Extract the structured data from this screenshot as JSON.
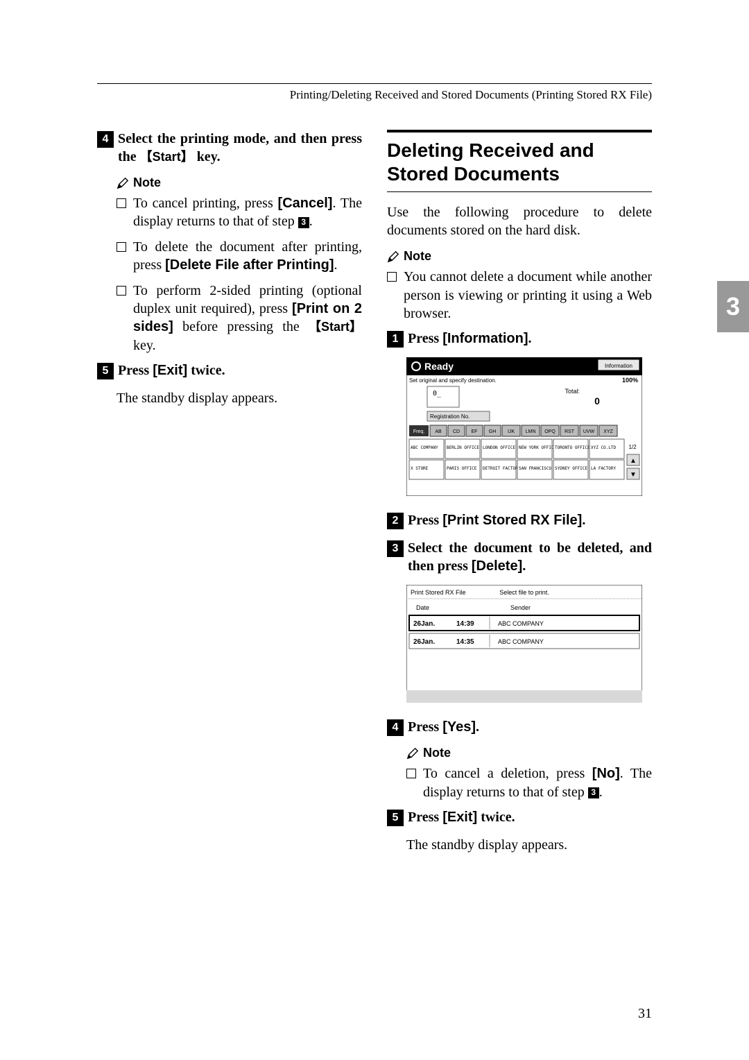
{
  "runningHead": "Printing/Deleting Received and Stored Documents (Printing Stored RX File)",
  "left": {
    "step4": {
      "num": "4",
      "textA": "Select the printing mode, and then press the ",
      "key": "Start",
      "textB": " key."
    },
    "noteLabel": "Note",
    "bullets": {
      "b1a": "To cancel printing, press ",
      "b1label": "[Cancel]",
      "b1b": ". The display returns to that of step ",
      "b1ref": "3",
      "b1c": ".",
      "b2a": "To delete the document after printing, press ",
      "b2label": "[Delete File after Printing]",
      "b2b": ".",
      "b3a": "To perform 2-sided printing (optional duplex unit required), press ",
      "b3label": "[Print on 2 sides]",
      "b3b": " before pressing the ",
      "b3key": "Start",
      "b3c": " key."
    },
    "step5": {
      "num": "5",
      "textA": "Press ",
      "label": "[Exit]",
      "textB": " twice."
    },
    "standby": "The standby display appears."
  },
  "right": {
    "sectionTitle": "Deleting Received and Stored Documents",
    "intro": "Use the following procedure to delete documents stored on the hard disk.",
    "noteLabel": "Note",
    "noteBullet": "You cannot delete a document while another person is viewing or printing it using a Web browser.",
    "step1": {
      "num": "1",
      "textA": "Press ",
      "label": "[Information]",
      "textB": "."
    },
    "shot1": {
      "ready": "Ready",
      "sub": "Set original and specify destination.",
      "info": "Information",
      "pct": "100%",
      "total": "Total:",
      "totalVal": "0",
      "regno": "Registration No.",
      "tabs": [
        "Freq.",
        "AB",
        "CD",
        "EF",
        "GH",
        "IJK",
        "LMN",
        "OPQ",
        "RST",
        "UVW",
        "XYZ"
      ],
      "cells": [
        "ABC COMPANY",
        "BERLIN OFFICE",
        "LONDON OFFICE",
        "NEW YORK OFFICE",
        "TORONTO OFFICE",
        "XYZ CO.LTD",
        "X STORE",
        "PARIS OFFICE",
        "DETROIT FACTORY",
        "SAN FRANCISCO",
        "SYDNEY OFFICE",
        "LA FACTORY"
      ],
      "page": "1/2"
    },
    "step2": {
      "num": "2",
      "textA": "Press ",
      "label": "[Print Stored RX File]",
      "textB": "."
    },
    "step3": {
      "num": "3",
      "textA": "Select the document to be deleted, and then press ",
      "label": "[Delete]",
      "textB": "."
    },
    "shot2": {
      "title": "Print Stored RX File",
      "sub": "Select file to print.",
      "dateH": "Date",
      "senderH": "Sender",
      "r1d": "26Jan.",
      "r1t": "14:39",
      "r1s": "ABC COMPANY",
      "r2d": "26Jan.",
      "r2t": "14:35",
      "r2s": "ABC COMPANY"
    },
    "step4": {
      "num": "4",
      "textA": "Press ",
      "label": "[Yes]",
      "textB": "."
    },
    "noteLabel2": "Note",
    "note2a": "To cancel a deletion, press ",
    "note2label": "[No]",
    "note2b": ". The display returns to that of step ",
    "note2ref": "3",
    "note2c": ".",
    "step5": {
      "num": "5",
      "textA": "Press ",
      "label": "[Exit]",
      "textB": " twice."
    },
    "standby": "The standby display appears."
  },
  "sideTab": "3",
  "pageNum": "31"
}
